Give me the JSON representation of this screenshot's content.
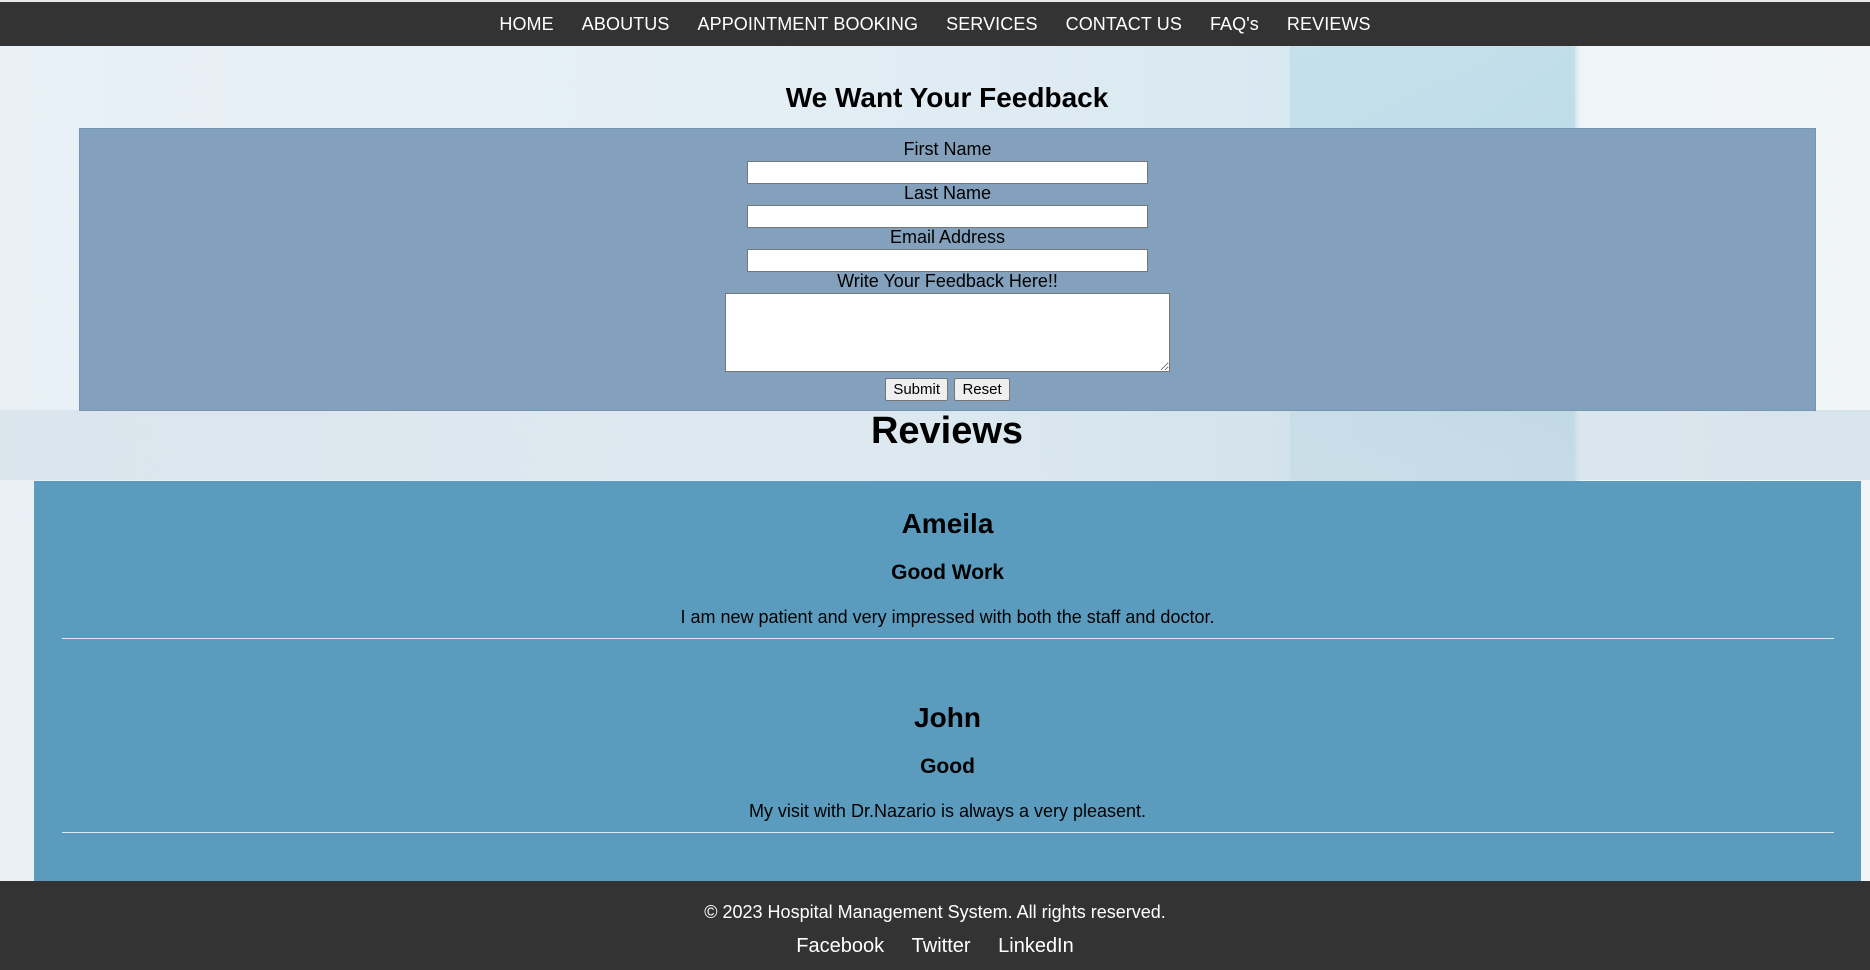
{
  "nav": {
    "items": [
      {
        "label": "HOME"
      },
      {
        "label": "ABOUTUS"
      },
      {
        "label": "APPOINTMENT BOOKING"
      },
      {
        "label": "SERVICES"
      },
      {
        "label": "CONTACT US"
      },
      {
        "label": "FAQ's"
      },
      {
        "label": "REVIEWS"
      }
    ]
  },
  "feedback": {
    "title": "We Want Your Feedback",
    "first_name_label": "First Name",
    "first_name_value": "",
    "last_name_label": "Last Name",
    "last_name_value": "",
    "email_label": "Email Address",
    "email_value": "",
    "feedback_label": "Write Your Feedback Here!!",
    "feedback_value": "",
    "submit_label": "Submit",
    "reset_label": "Reset"
  },
  "reviews": {
    "title": "Reviews",
    "items": [
      {
        "name": "Ameila",
        "subject": "Good Work",
        "text": "I am new patient and very impressed with both the staff and doctor."
      },
      {
        "name": "John",
        "subject": "Good",
        "text": "My visit with Dr.Nazario is always a very pleasent."
      }
    ]
  },
  "footer": {
    "copyright": "© 2023 Hospital Management System. All rights reserved.",
    "links": [
      {
        "label": "Facebook"
      },
      {
        "label": "Twitter"
      },
      {
        "label": "LinkedIn"
      }
    ]
  },
  "colors": {
    "navbar_bg": "#333333",
    "feedback_box_bg": "#83a1bc",
    "reviews_box_bg": "#5b9cbe",
    "footer_bg": "#333333"
  }
}
